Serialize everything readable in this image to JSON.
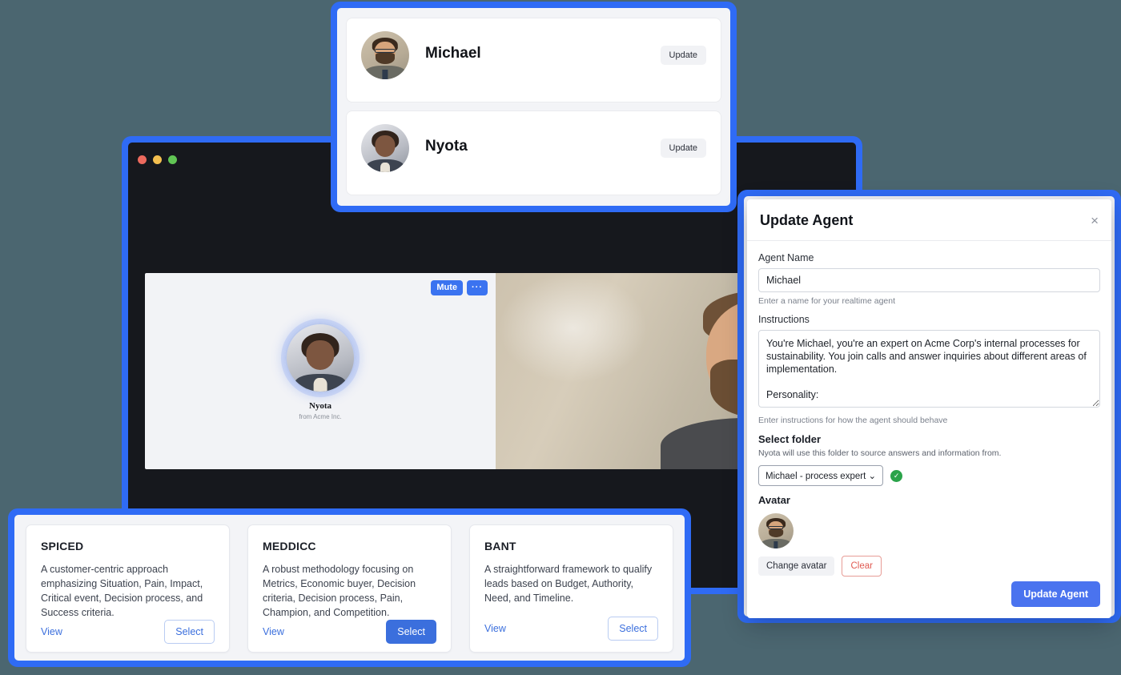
{
  "app_window": {
    "traffic_lights": [
      "close",
      "minimize",
      "maximize"
    ],
    "call": {
      "agent_tile": {
        "mute_label": "Mute",
        "more_label": "···",
        "name": "Nyota",
        "org": "from Acme Inc."
      }
    }
  },
  "agent_list": {
    "agents": [
      {
        "name": "Michael",
        "action_label": "Update"
      },
      {
        "name": "Nyota",
        "action_label": "Update"
      }
    ]
  },
  "methodologies": {
    "cards": [
      {
        "title": "SPICED",
        "description": "A customer-centric approach emphasizing Situation, Pain, Impact, Critical event, Decision process, and Success criteria.",
        "view_label": "View",
        "select_label": "Select",
        "select_style": "outline"
      },
      {
        "title": "MEDDICC",
        "description": "A robust methodology focusing on Metrics, Economic buyer, Decision criteria, Decision process, Pain, Champion, and Competition.",
        "view_label": "View",
        "select_label": "Select",
        "select_style": "primary"
      },
      {
        "title": "BANT",
        "description": "A straightforward framework to qualify leads based on Budget, Authority, Need, and Timeline.",
        "view_label": "View",
        "select_label": "Select",
        "select_style": "outline"
      }
    ]
  },
  "update_modal": {
    "title": "Update Agent",
    "close_label": "×",
    "agent_name": {
      "label": "Agent Name",
      "value": "Michael",
      "placeholder": "Agent name",
      "hint": "Enter a name for your realtime agent"
    },
    "instructions": {
      "label": "Instructions",
      "value": "You're Michael, you're an expert on Acme Corp's internal processes for sustainability. You join calls and answer inquiries about different areas of implementation.\n\nPersonality:",
      "placeholder": "Instructions",
      "hint": "Enter instructions for how the agent should behave"
    },
    "folder": {
      "title": "Select folder",
      "subtitle": "Nyota will use this folder to source answers and information from.",
      "selected": "Michael - process expert",
      "chevron": "⌄",
      "status_icon": "check-circle"
    },
    "avatar": {
      "title": "Avatar",
      "change_label": "Change avatar",
      "clear_label": "Clear"
    },
    "submit_label": "Update Agent"
  },
  "colors": {
    "frame_blue": "#2f6bf5",
    "page_background": "#4b6670",
    "primary": "#3b6fdd",
    "danger": "#e05a52",
    "success": "#2aa34a",
    "window_dark": "#16181d"
  }
}
